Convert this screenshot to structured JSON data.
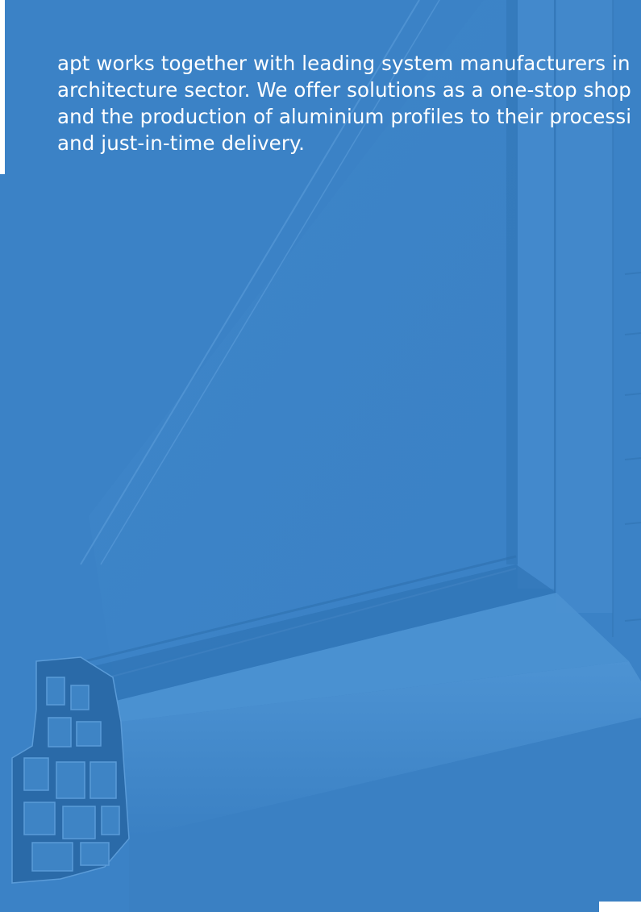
{
  "page": {
    "background_color": "#3b82c6",
    "accent_color": "#ffffff",
    "illustration": "window-profile-cross-section"
  },
  "intro": {
    "lines": [
      "apt works together with leading system manufacturers in",
      "architecture sector. We offer solutions as a one-stop shop",
      "and the production of aluminium profiles to their processi",
      "and just-in-time delivery."
    ]
  }
}
